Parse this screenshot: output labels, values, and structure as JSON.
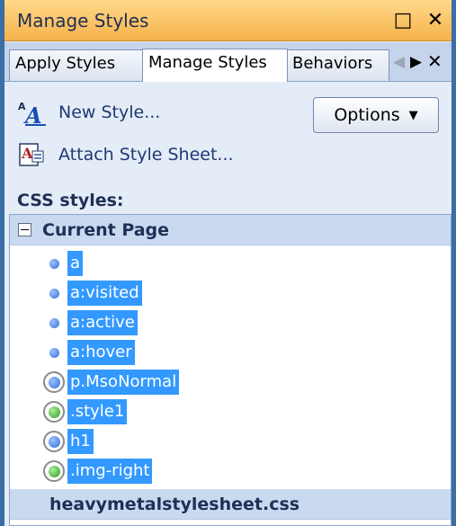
{
  "window": {
    "title": "Manage Styles",
    "maximize_glyph": "□",
    "close_glyph": "✕"
  },
  "tabs": [
    {
      "label": "Apply Styles",
      "active": false
    },
    {
      "label": "Manage Styles",
      "active": true
    },
    {
      "label": "Behaviors",
      "active": false
    }
  ],
  "tab_nav": {
    "left": "◀",
    "right": "▶",
    "close": "✕"
  },
  "actions": {
    "new_style": {
      "label": "New Style...",
      "icon": "new-style-icon"
    },
    "attach_sheet": {
      "label": "Attach Style Sheet...",
      "icon": "attach-style-sheet-icon"
    }
  },
  "options_button": {
    "label": "Options",
    "arrow": "▼"
  },
  "css_styles_label": "CSS styles:",
  "tree": {
    "groups": [
      {
        "label": "Current Page",
        "expanded": true,
        "rules": [
          {
            "selector": "a",
            "icon": "blue-dot"
          },
          {
            "selector": "a:visited",
            "icon": "blue-dot"
          },
          {
            "selector": "a:active",
            "icon": "blue-dot"
          },
          {
            "selector": "a:hover",
            "icon": "blue-dot"
          },
          {
            "selector": "p.MsoNormal",
            "icon": "blue-dot-ringed"
          },
          {
            "selector": ".style1",
            "icon": "green-dot-ringed"
          },
          {
            "selector": "h1",
            "icon": "blue-dot-ringed"
          },
          {
            "selector": ".img-right",
            "icon": "green-dot-ringed"
          }
        ]
      },
      {
        "label": "heavymetalstylesheet.css",
        "expanded": false,
        "rules": []
      }
    ]
  },
  "colors": {
    "title_bar": "#f6b24b",
    "selection": "#3399ff",
    "group_header": "#c9d9f0",
    "panel_bg": "#e4ecf7"
  }
}
